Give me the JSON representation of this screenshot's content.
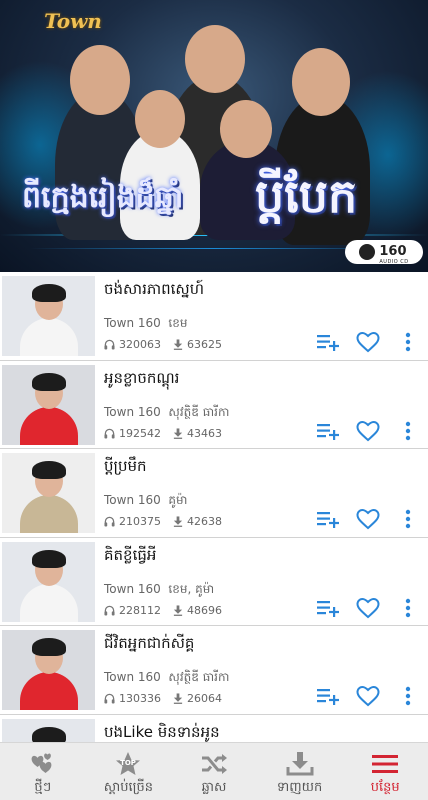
{
  "banner": {
    "brand": "Town",
    "title_left": "ពីក្មេងរៀងដ៏ឆ្នាំ",
    "title_right": "ប្តីបែក",
    "badge_number": "160",
    "badge_sub": "AUDIO CD"
  },
  "tracks": [
    {
      "title": "ចង់សារភាពស្នេហ៍",
      "album": "Town 160",
      "artist": "ខេម",
      "plays": "320063",
      "downloads": "63625",
      "thumb_bg": "#e4e7ec",
      "body_color": "#f5f5f5"
    },
    {
      "title": "អូនខ្លាចកណ្ដុរ",
      "album": "Town 160",
      "artist": "សុវត្ថិឌី ធារីកា",
      "plays": "192542",
      "downloads": "43463",
      "thumb_bg": "#d9dbe0",
      "body_color": "#e0262e"
    },
    {
      "title": "ប្តីប្រមឹក",
      "album": "Town 160",
      "artist": "គូម៉ា",
      "plays": "210375",
      "downloads": "42638",
      "thumb_bg": "#eeeeee",
      "body_color": "#c8b796"
    },
    {
      "title": "គិតខ្លីធ្វើអី",
      "album": "Town 160",
      "artist": "ខេម, គូម៉ា",
      "plays": "228112",
      "downloads": "48696",
      "thumb_bg": "#e4e7ec",
      "body_color": "#f5f5f5"
    },
    {
      "title": "ជីវិតអ្នកជាក់សីគ្គ",
      "album": "Town 160",
      "artist": "សុវត្ថិឌី ធារីកា",
      "plays": "130336",
      "downloads": "26064",
      "thumb_bg": "#d9dbe0",
      "body_color": "#e0262e"
    },
    {
      "title": "បងLike មិនទាន់អូន",
      "album": "",
      "artist": "",
      "plays": "",
      "downloads": "",
      "thumb_bg": "#e4e7ec",
      "body_color": "#f5f5f5"
    }
  ],
  "nav": [
    {
      "label": "ថ្មីៗ",
      "icon": "hearts-icon"
    },
    {
      "label": "ស្តាប់ច្រើន",
      "icon": "top-star-icon",
      "badge": "TOP"
    },
    {
      "label": "ឆ្លាស",
      "icon": "shuffle-icon"
    },
    {
      "label": "ទាញយក",
      "icon": "download-icon"
    },
    {
      "label": "បន្ថែម",
      "icon": "menu-icon",
      "active": true
    }
  ],
  "colors": {
    "accent_blue": "#2a86d9",
    "active_red": "#d32432",
    "icon_gray": "#8c8c8c"
  }
}
